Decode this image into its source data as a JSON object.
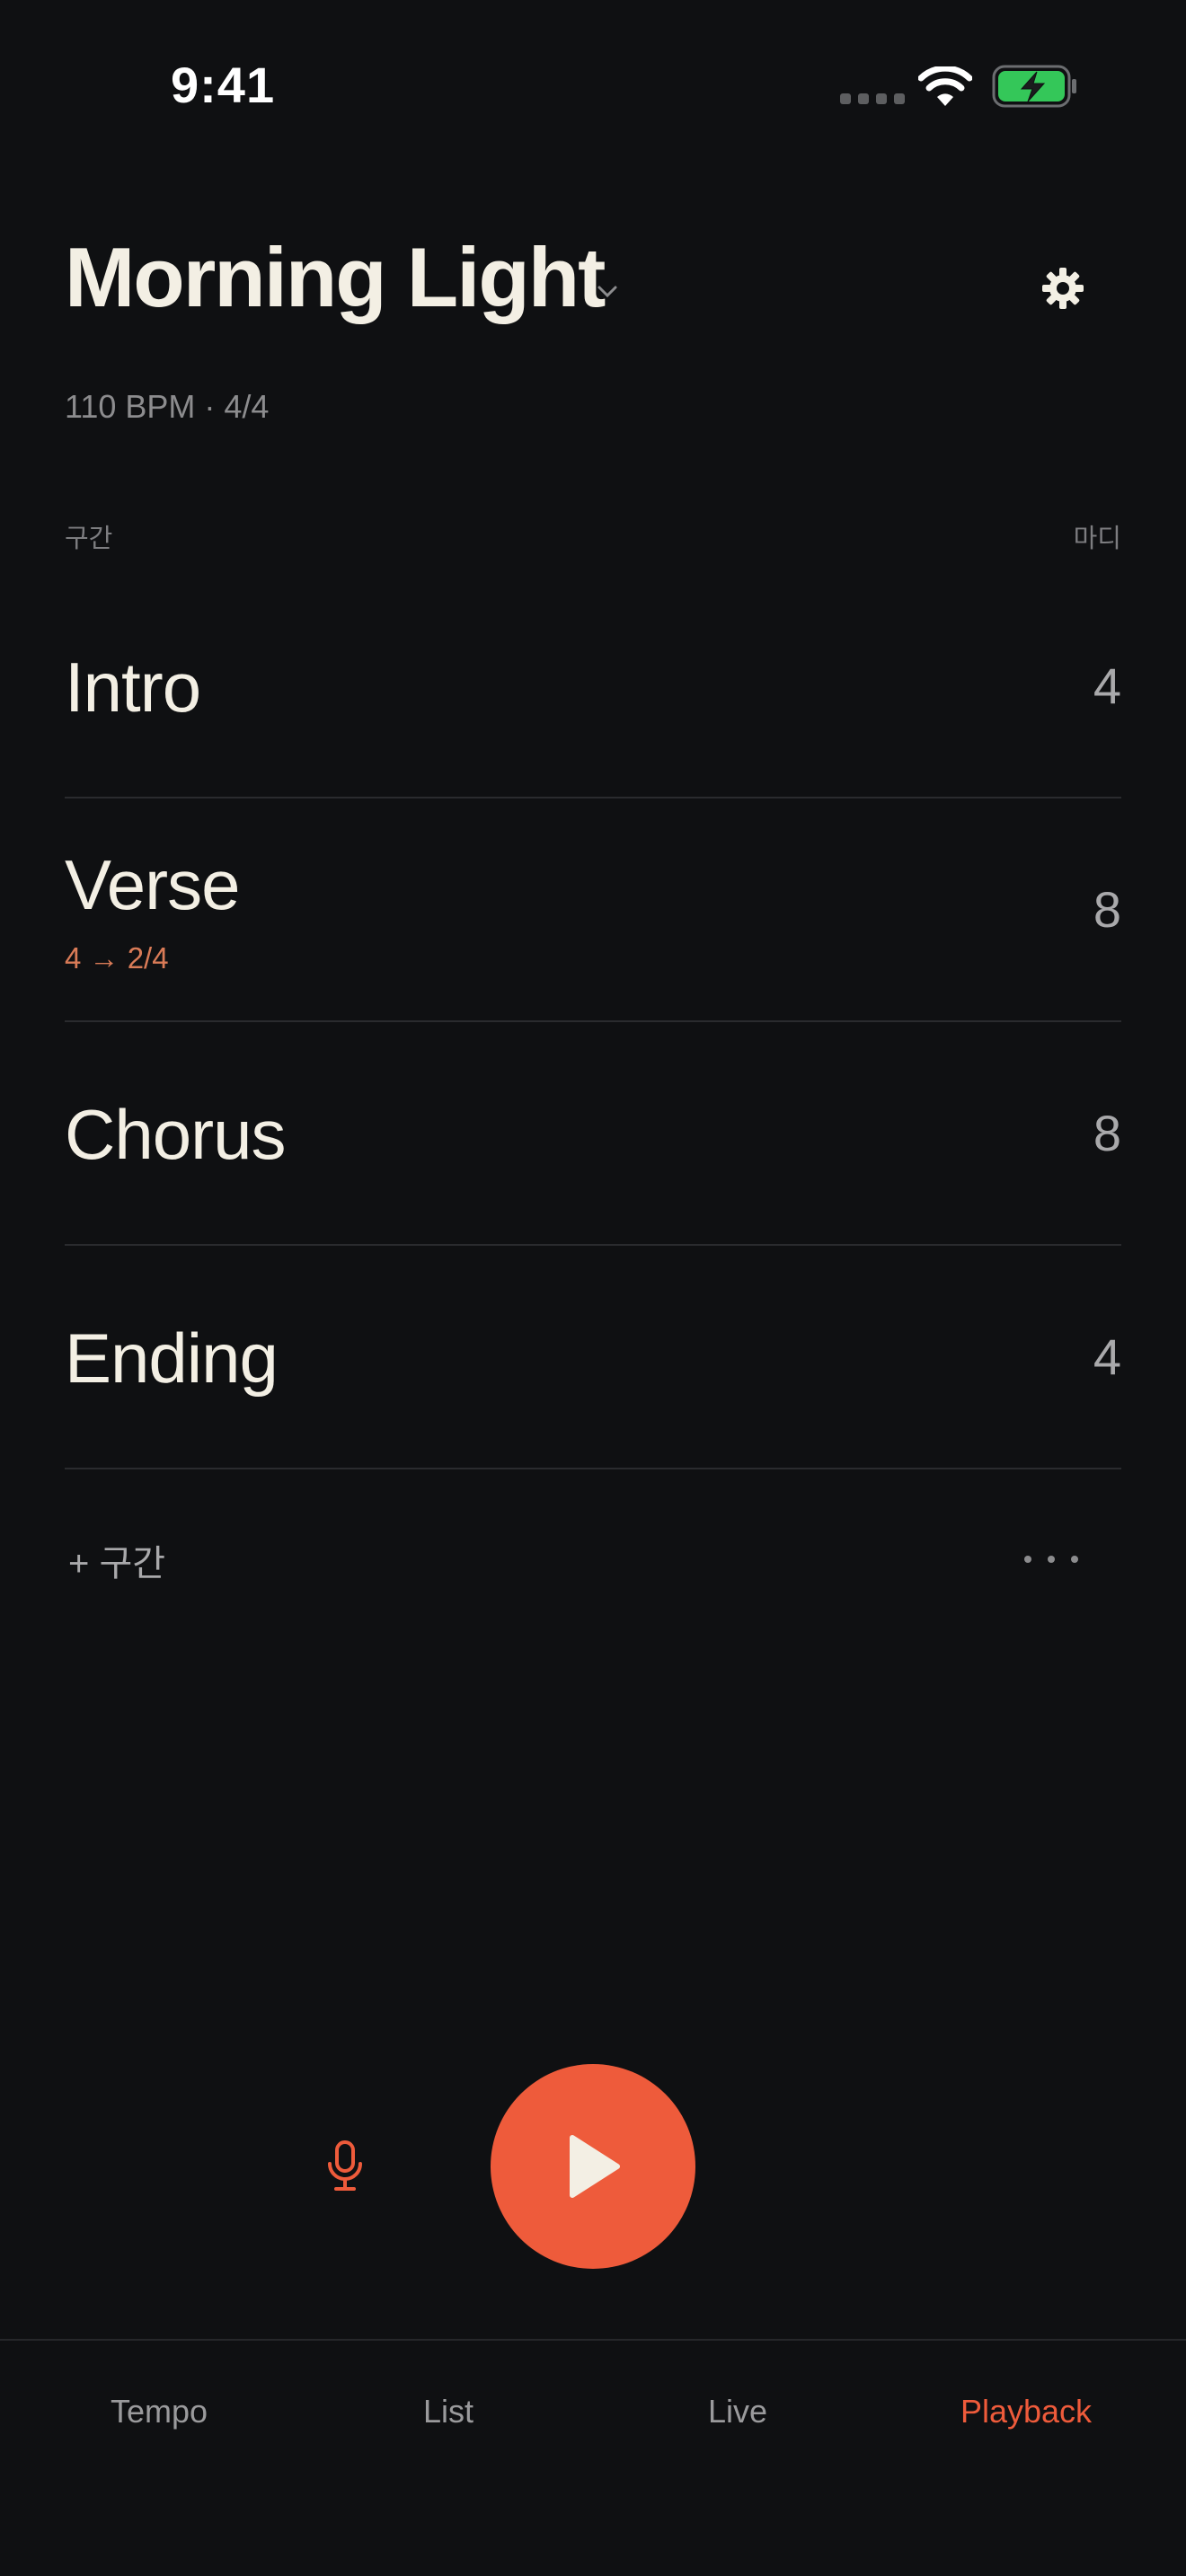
{
  "status_bar": {
    "time": "9:41",
    "icons": [
      "signal-icon",
      "wifi-icon",
      "battery-charging-icon"
    ],
    "battery_color": "#34c759"
  },
  "header": {
    "title": "Morning Light",
    "meta": "110 BPM · 4/4",
    "icons": [
      "chevron-down-icon",
      "gear-icon"
    ]
  },
  "list": {
    "column_left": "구간",
    "column_right": "마디",
    "sections": [
      {
        "name": "Intro",
        "bars": "4",
        "sub": ""
      },
      {
        "name": "Verse",
        "bars": "8",
        "sub": "4 → 2/4"
      },
      {
        "name": "Chorus",
        "bars": "8",
        "sub": ""
      },
      {
        "name": "Ending",
        "bars": "4",
        "sub": ""
      }
    ],
    "add_label": "+ 구간",
    "more_icon": "more-horizontal-icon"
  },
  "controls": {
    "mic_icon": "microphone-icon",
    "play_icon": "play-icon"
  },
  "tabs": [
    {
      "label": "Tempo",
      "active": false
    },
    {
      "label": "List",
      "active": false
    },
    {
      "label": "Live",
      "active": false
    },
    {
      "label": "Playback",
      "active": true
    }
  ],
  "colors": {
    "background": "#0f1012",
    "accent": "#ee5b3b",
    "text_primary": "#f3efe4",
    "text_secondary": "#8c8c8e",
    "sub_label": "#d97b57"
  }
}
